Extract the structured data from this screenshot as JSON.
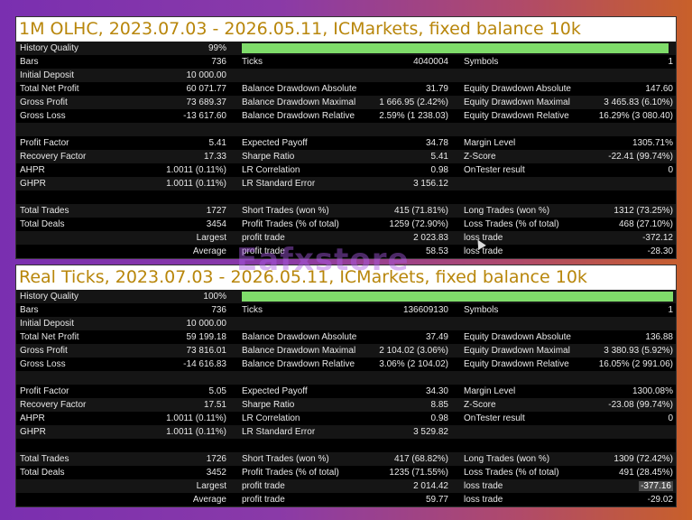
{
  "watermark": "Eafxstore",
  "reports": [
    {
      "title": "1M OLHC, 2023.07.03 - 2026.05.11, ICMarkets, fixed balance 10k",
      "history_quality": {
        "label": "History Quality",
        "value": "99%",
        "fraction": 0.99
      },
      "rows": [
        {
          "gap": false,
          "c1": [
            "Bars",
            "736"
          ],
          "c2": [
            "Ticks",
            "4040004"
          ],
          "c3": [
            "Symbols",
            "1"
          ]
        },
        {
          "gap": false,
          "c1": [
            "Initial Deposit",
            "10 000.00"
          ],
          "c2": [
            "",
            ""
          ],
          "c3": [
            "",
            ""
          ]
        },
        {
          "gap": false,
          "c1": [
            "Total Net Profit",
            "60 071.77"
          ],
          "c2": [
            "Balance Drawdown Absolute",
            "31.79"
          ],
          "c3": [
            "Equity Drawdown Absolute",
            "147.60"
          ]
        },
        {
          "gap": false,
          "c1": [
            "Gross Profit",
            "73 689.37"
          ],
          "c2": [
            "Balance Drawdown Maximal",
            "1 666.95 (2.42%)"
          ],
          "c3": [
            "Equity Drawdown Maximal",
            "3 465.83 (6.10%)"
          ]
        },
        {
          "gap": false,
          "c1": [
            "Gross Loss",
            "-13 617.60"
          ],
          "c2": [
            "Balance Drawdown Relative",
            "2.59% (1 238.03)"
          ],
          "c3": [
            "Equity Drawdown Relative",
            "16.29% (3 080.40)"
          ]
        },
        {
          "gap": true
        },
        {
          "gap": false,
          "c1": [
            "Profit Factor",
            "5.41"
          ],
          "c2": [
            "Expected Payoff",
            "34.78"
          ],
          "c3": [
            "Margin Level",
            "1305.71%"
          ]
        },
        {
          "gap": false,
          "c1": [
            "Recovery Factor",
            "17.33"
          ],
          "c2": [
            "Sharpe Ratio",
            "5.41"
          ],
          "c3": [
            "Z-Score",
            "-22.41 (99.74%)"
          ]
        },
        {
          "gap": false,
          "c1": [
            "AHPR",
            "1.0011 (0.11%)"
          ],
          "c2": [
            "LR Correlation",
            "0.98"
          ],
          "c3": [
            "OnTester result",
            "0"
          ]
        },
        {
          "gap": false,
          "c1": [
            "GHPR",
            "1.0011 (0.11%)"
          ],
          "c2": [
            "LR Standard Error",
            "3 156.12"
          ],
          "c3": [
            "",
            ""
          ]
        },
        {
          "gap": true
        },
        {
          "gap": false,
          "c1": [
            "Total Trades",
            "1727"
          ],
          "c2": [
            "Short Trades (won %)",
            "415 (71.81%)"
          ],
          "c3": [
            "Long Trades (won %)",
            "1312 (73.25%)"
          ]
        },
        {
          "gap": false,
          "c1": [
            "Total Deals",
            "3454"
          ],
          "c2": [
            "Profit Trades (% of total)",
            "1259 (72.90%)"
          ],
          "c3": [
            "Loss Trades (% of total)",
            "468 (27.10%)"
          ]
        },
        {
          "gap": false,
          "c1": [
            "",
            "Largest"
          ],
          "c2": [
            "profit trade",
            "2 023.83"
          ],
          "c3": [
            "loss trade",
            "-372.12"
          ]
        },
        {
          "gap": false,
          "c1": [
            "",
            "Average"
          ],
          "c2": [
            "profit trade",
            "58.53"
          ],
          "c3": [
            "loss trade",
            "-28.30"
          ]
        }
      ]
    },
    {
      "title": "Real Ticks, 2023.07.03 - 2026.05.11, ICMarkets, fixed balance 10k",
      "history_quality": {
        "label": "History Quality",
        "value": "100%",
        "fraction": 1.0
      },
      "rows": [
        {
          "gap": false,
          "c1": [
            "Bars",
            "736"
          ],
          "c2": [
            "Ticks",
            "136609130"
          ],
          "c3": [
            "Symbols",
            "1"
          ]
        },
        {
          "gap": false,
          "c1": [
            "Initial Deposit",
            "10 000.00"
          ],
          "c2": [
            "",
            ""
          ],
          "c3": [
            "",
            ""
          ]
        },
        {
          "gap": false,
          "c1": [
            "Total Net Profit",
            "59 199.18"
          ],
          "c2": [
            "Balance Drawdown Absolute",
            "37.49"
          ],
          "c3": [
            "Equity Drawdown Absolute",
            "136.88"
          ]
        },
        {
          "gap": false,
          "c1": [
            "Gross Profit",
            "73 816.01"
          ],
          "c2": [
            "Balance Drawdown Maximal",
            "2 104.02 (3.06%)"
          ],
          "c3": [
            "Equity Drawdown Maximal",
            "3 380.93 (5.92%)"
          ]
        },
        {
          "gap": false,
          "c1": [
            "Gross Loss",
            "-14 616.83"
          ],
          "c2": [
            "Balance Drawdown Relative",
            "3.06% (2 104.02)"
          ],
          "c3": [
            "Equity Drawdown Relative",
            "16.05% (2 991.06)"
          ]
        },
        {
          "gap": true
        },
        {
          "gap": false,
          "c1": [
            "Profit Factor",
            "5.05"
          ],
          "c2": [
            "Expected Payoff",
            "34.30"
          ],
          "c3": [
            "Margin Level",
            "1300.08%"
          ]
        },
        {
          "gap": false,
          "c1": [
            "Recovery Factor",
            "17.51"
          ],
          "c2": [
            "Sharpe Ratio",
            "8.85"
          ],
          "c3": [
            "Z-Score",
            "-23.08 (99.74%)"
          ]
        },
        {
          "gap": false,
          "c1": [
            "AHPR",
            "1.0011 (0.11%)"
          ],
          "c2": [
            "LR Correlation",
            "0.98"
          ],
          "c3": [
            "OnTester result",
            "0"
          ]
        },
        {
          "gap": false,
          "c1": [
            "GHPR",
            "1.0011 (0.11%)"
          ],
          "c2": [
            "LR Standard Error",
            "3 529.82"
          ],
          "c3": [
            "",
            ""
          ]
        },
        {
          "gap": true
        },
        {
          "gap": false,
          "c1": [
            "Total Trades",
            "1726"
          ],
          "c2": [
            "Short Trades (won %)",
            "417 (68.82%)"
          ],
          "c3": [
            "Long Trades (won %)",
            "1309 (72.42%)"
          ]
        },
        {
          "gap": false,
          "c1": [
            "Total Deals",
            "3452"
          ],
          "c2": [
            "Profit Trades (% of total)",
            "1235 (71.55%)"
          ],
          "c3": [
            "Loss Trades (% of total)",
            "491 (28.45%)"
          ]
        },
        {
          "gap": false,
          "c1": [
            "",
            "Largest"
          ],
          "c2": [
            "profit trade",
            "2 014.42"
          ],
          "c3": [
            "loss trade",
            "-377.16"
          ],
          "highlight_c3": true
        },
        {
          "gap": false,
          "c1": [
            "",
            "Average"
          ],
          "c2": [
            "profit trade",
            "59.77"
          ],
          "c3": [
            "loss trade",
            "-29.02"
          ]
        }
      ]
    }
  ]
}
